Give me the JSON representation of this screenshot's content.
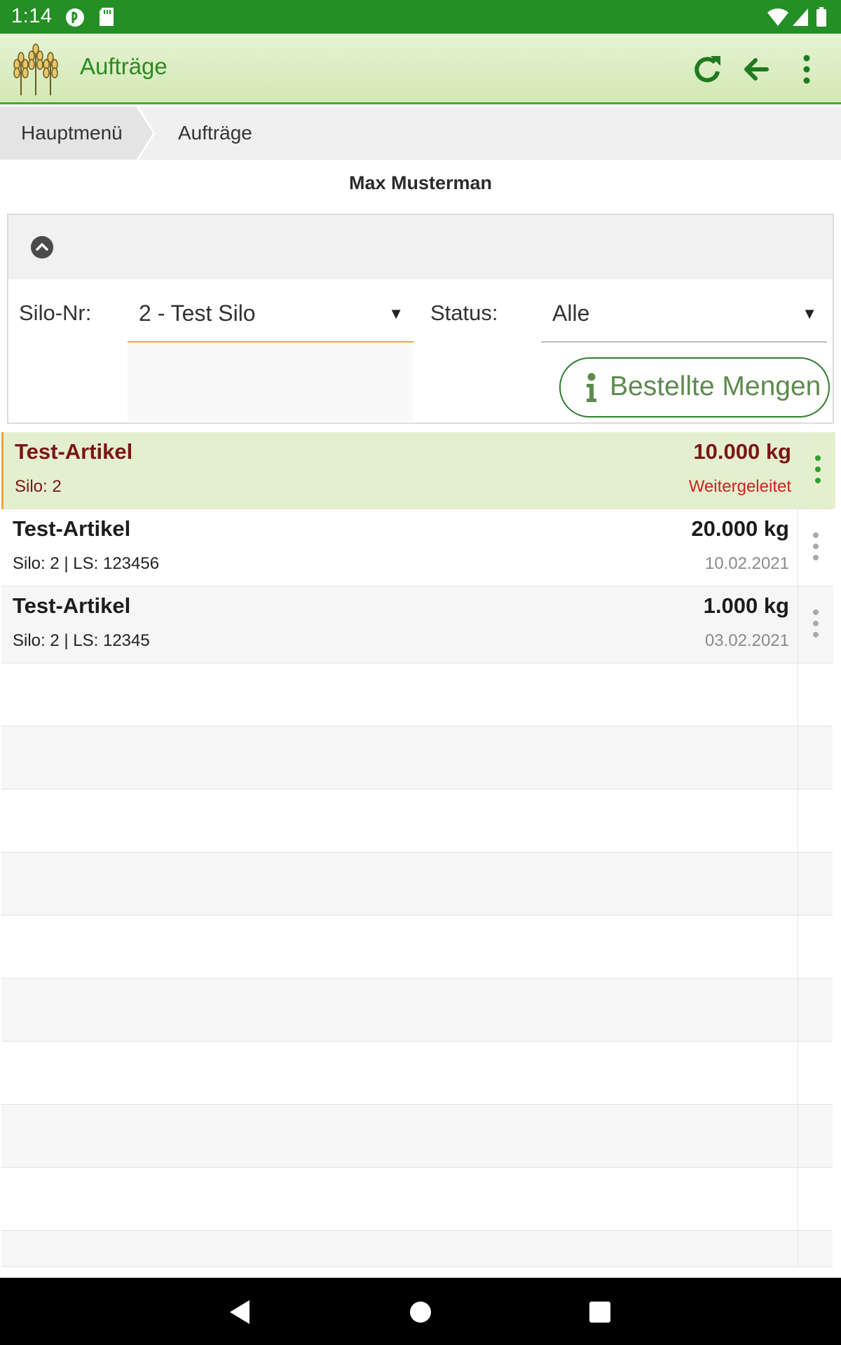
{
  "status_bar": {
    "time": "1:14"
  },
  "app_bar": {
    "title": "Aufträge",
    "accent": "#2d8a22"
  },
  "breadcrumb": {
    "home": "Hauptmenü",
    "current": "Aufträge"
  },
  "user": {
    "name": "Max Musterman"
  },
  "filter": {
    "silo_label": "Silo-Nr:",
    "silo_value": "2 - Test Silo",
    "status_label": "Status:",
    "status_value": "Alle",
    "button_label": "Bestellte Mengen"
  },
  "orders": [
    {
      "name": "Test-Artikel",
      "sub": "Silo: 2",
      "qty": "10.000 kg",
      "meta": "Weitergeleitet"
    },
    {
      "name": "Test-Artikel",
      "sub": "Silo: 2 | LS: 123456",
      "qty": "20.000 kg",
      "meta": "10.02.2021"
    },
    {
      "name": "Test-Artikel",
      "sub": "Silo: 2 | LS: 12345",
      "qty": "1.000 kg",
      "meta": "03.02.2021"
    }
  ],
  "icons": {
    "refresh": "refresh-icon",
    "back": "arrow-left-icon",
    "menu": "more-vert-icon",
    "collapse": "chevron-up-icon",
    "info": "info-icon"
  }
}
